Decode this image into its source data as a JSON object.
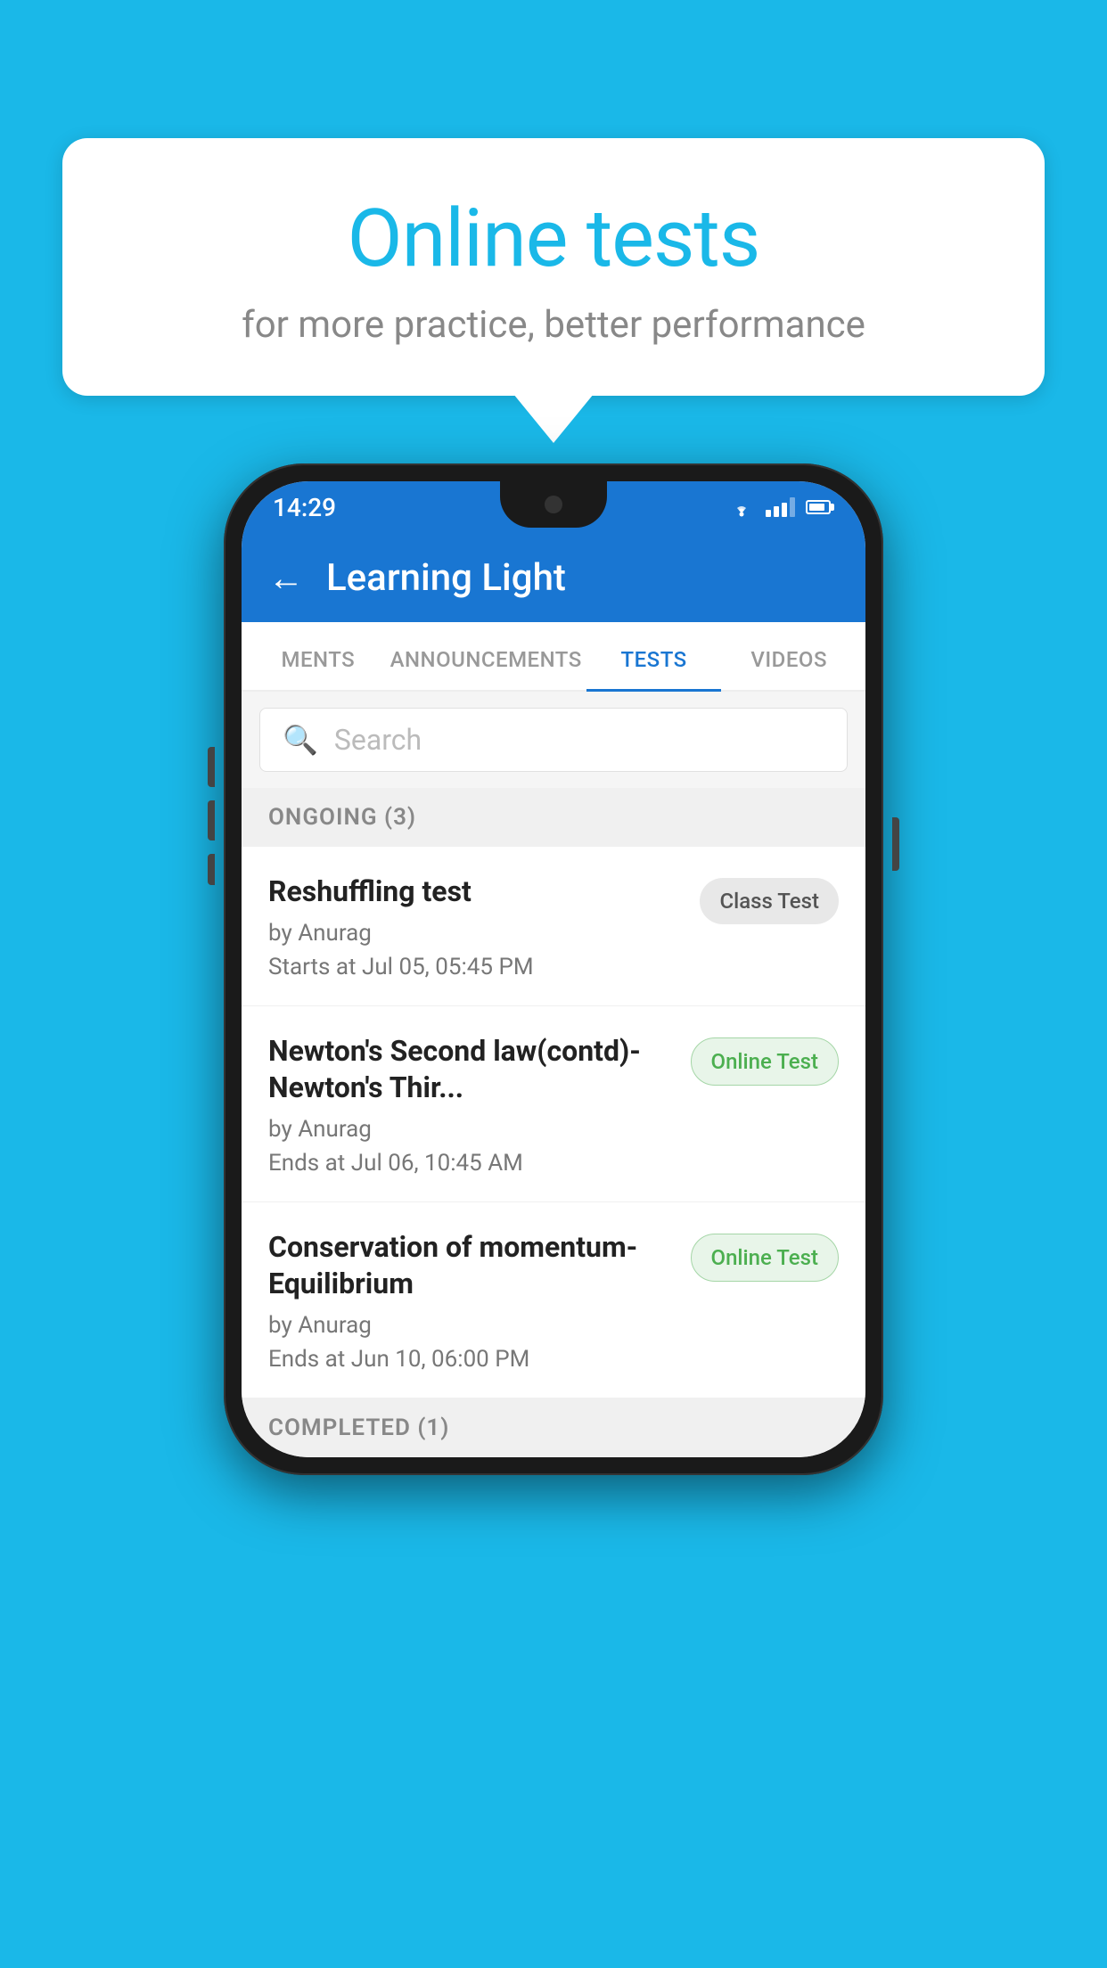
{
  "background_color": "#1ab8e8",
  "speech_bubble": {
    "title": "Online tests",
    "subtitle": "for more practice, better performance"
  },
  "phone": {
    "status_bar": {
      "time": "14:29"
    },
    "app_bar": {
      "title": "Learning Light",
      "back_label": "←"
    },
    "tabs": [
      {
        "label": "MENTS",
        "active": false
      },
      {
        "label": "ANNOUNCEMENTS",
        "active": false
      },
      {
        "label": "TESTS",
        "active": true
      },
      {
        "label": "VIDEOS",
        "active": false
      }
    ],
    "search": {
      "placeholder": "Search"
    },
    "ongoing_section": {
      "label": "ONGOING (3)"
    },
    "tests": [
      {
        "name": "Reshuffling test",
        "by": "by Anurag",
        "time": "Starts at  Jul 05, 05:45 PM",
        "badge": "Class Test",
        "badge_type": "class"
      },
      {
        "name": "Newton's Second law(contd)-Newton's Thir...",
        "by": "by Anurag",
        "time": "Ends at  Jul 06, 10:45 AM",
        "badge": "Online Test",
        "badge_type": "online"
      },
      {
        "name": "Conservation of momentum-Equilibrium",
        "by": "by Anurag",
        "time": "Ends at  Jun 10, 06:00 PM",
        "badge": "Online Test",
        "badge_type": "online"
      }
    ],
    "completed_section": {
      "label": "COMPLETED (1)"
    }
  }
}
